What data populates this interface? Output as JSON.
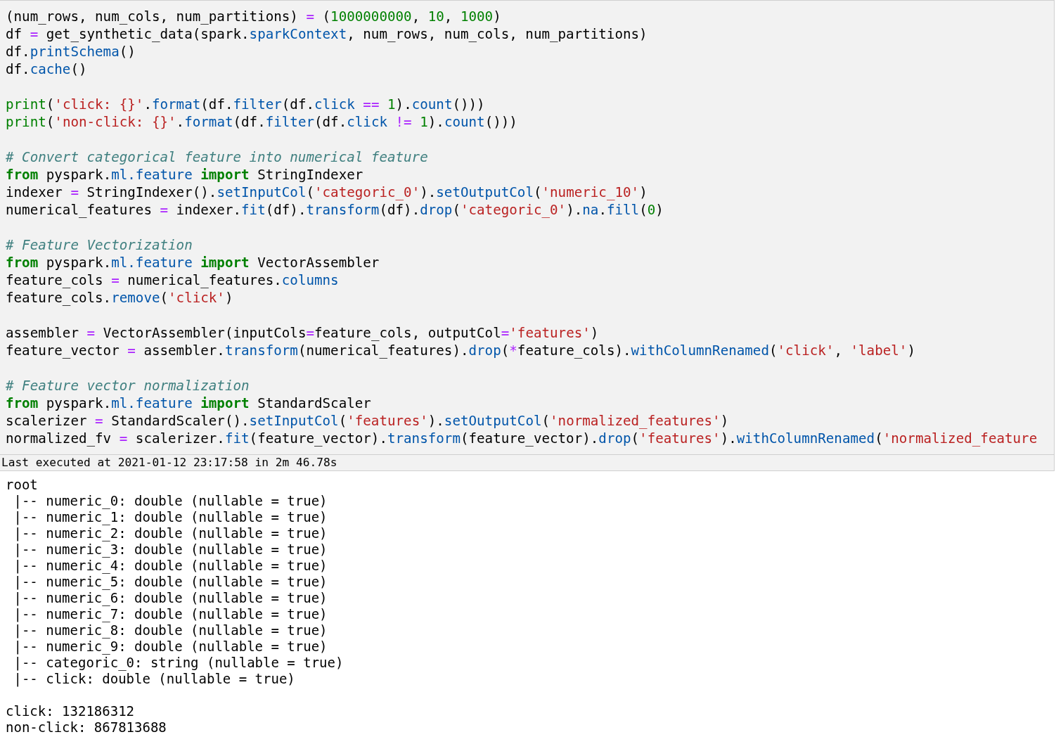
{
  "code_cell": {
    "blocks": [
      [
        {
          "tokens": [
            {
              "kind": "plain",
              "text": "(num_rows, num_cols, num_partitions) "
            },
            {
              "kind": "op",
              "text": "="
            },
            {
              "kind": "plain",
              "text": " ("
            },
            {
              "kind": "num",
              "text": "1000000000"
            },
            {
              "kind": "plain",
              "text": ", "
            },
            {
              "kind": "num",
              "text": "10"
            },
            {
              "kind": "plain",
              "text": ", "
            },
            {
              "kind": "num",
              "text": "1000"
            },
            {
              "kind": "plain",
              "text": ")"
            }
          ]
        },
        {
          "tokens": [
            {
              "kind": "plain",
              "text": "df "
            },
            {
              "kind": "op",
              "text": "="
            },
            {
              "kind": "plain",
              "text": " get_synthetic_data(spark."
            },
            {
              "kind": "attr",
              "text": "sparkContext"
            },
            {
              "kind": "plain",
              "text": ", num_rows, num_cols, num_partitions)"
            }
          ]
        },
        {
          "tokens": [
            {
              "kind": "plain",
              "text": "df."
            },
            {
              "kind": "attr",
              "text": "printSchema"
            },
            {
              "kind": "plain",
              "text": "()"
            }
          ]
        },
        {
          "tokens": [
            {
              "kind": "plain",
              "text": "df."
            },
            {
              "kind": "attr",
              "text": "cache"
            },
            {
              "kind": "plain",
              "text": "()"
            }
          ]
        }
      ],
      [
        {
          "tokens": [
            {
              "kind": "builtin",
              "text": "print"
            },
            {
              "kind": "plain",
              "text": "("
            },
            {
              "kind": "str",
              "text": "'click: {}'"
            },
            {
              "kind": "plain",
              "text": "."
            },
            {
              "kind": "attr",
              "text": "format"
            },
            {
              "kind": "plain",
              "text": "(df."
            },
            {
              "kind": "attr",
              "text": "filter"
            },
            {
              "kind": "plain",
              "text": "(df."
            },
            {
              "kind": "attr",
              "text": "click"
            },
            {
              "kind": "op",
              "text": " == "
            },
            {
              "kind": "num",
              "text": "1"
            },
            {
              "kind": "plain",
              "text": ")."
            },
            {
              "kind": "attr",
              "text": "count"
            },
            {
              "kind": "plain",
              "text": "()))"
            }
          ]
        },
        {
          "tokens": [
            {
              "kind": "builtin",
              "text": "print"
            },
            {
              "kind": "plain",
              "text": "("
            },
            {
              "kind": "str",
              "text": "'non-click: {}'"
            },
            {
              "kind": "plain",
              "text": "."
            },
            {
              "kind": "attr",
              "text": "format"
            },
            {
              "kind": "plain",
              "text": "(df."
            },
            {
              "kind": "attr",
              "text": "filter"
            },
            {
              "kind": "plain",
              "text": "(df."
            },
            {
              "kind": "attr",
              "text": "click"
            },
            {
              "kind": "op",
              "text": " != "
            },
            {
              "kind": "num",
              "text": "1"
            },
            {
              "kind": "plain",
              "text": ")."
            },
            {
              "kind": "attr",
              "text": "count"
            },
            {
              "kind": "plain",
              "text": "()))"
            }
          ]
        }
      ],
      [
        {
          "tokens": [
            {
              "kind": "comment",
              "text": "# Convert categorical feature into numerical feature"
            }
          ]
        },
        {
          "tokens": [
            {
              "kind": "keyword",
              "text": "from"
            },
            {
              "kind": "plain",
              "text": " pyspark."
            },
            {
              "kind": "attr",
              "text": "ml.feature"
            },
            {
              "kind": "keyword",
              "text": " import"
            },
            {
              "kind": "plain",
              "text": " StringIndexer"
            }
          ]
        },
        {
          "tokens": [
            {
              "kind": "plain",
              "text": "indexer "
            },
            {
              "kind": "op",
              "text": "="
            },
            {
              "kind": "plain",
              "text": " StringIndexer()."
            },
            {
              "kind": "attr",
              "text": "setInputCol"
            },
            {
              "kind": "plain",
              "text": "("
            },
            {
              "kind": "str",
              "text": "'categoric_0'"
            },
            {
              "kind": "plain",
              "text": ")."
            },
            {
              "kind": "attr",
              "text": "setOutputCol"
            },
            {
              "kind": "plain",
              "text": "("
            },
            {
              "kind": "str",
              "text": "'numeric_10'"
            },
            {
              "kind": "plain",
              "text": ")"
            }
          ]
        },
        {
          "tokens": [
            {
              "kind": "plain",
              "text": "numerical_features "
            },
            {
              "kind": "op",
              "text": "="
            },
            {
              "kind": "plain",
              "text": " indexer."
            },
            {
              "kind": "attr",
              "text": "fit"
            },
            {
              "kind": "plain",
              "text": "(df)."
            },
            {
              "kind": "attr",
              "text": "transform"
            },
            {
              "kind": "plain",
              "text": "(df)."
            },
            {
              "kind": "attr",
              "text": "drop"
            },
            {
              "kind": "plain",
              "text": "("
            },
            {
              "kind": "str",
              "text": "'categoric_0'"
            },
            {
              "kind": "plain",
              "text": ")."
            },
            {
              "kind": "attr",
              "text": "na"
            },
            {
              "kind": "plain",
              "text": "."
            },
            {
              "kind": "attr",
              "text": "fill"
            },
            {
              "kind": "plain",
              "text": "("
            },
            {
              "kind": "num",
              "text": "0"
            },
            {
              "kind": "plain",
              "text": ")"
            }
          ]
        }
      ],
      [
        {
          "tokens": [
            {
              "kind": "comment",
              "text": "# Feature Vectorization"
            }
          ]
        },
        {
          "tokens": [
            {
              "kind": "keyword",
              "text": "from"
            },
            {
              "kind": "plain",
              "text": " pyspark."
            },
            {
              "kind": "attr",
              "text": "ml.feature"
            },
            {
              "kind": "keyword",
              "text": " import"
            },
            {
              "kind": "plain",
              "text": " VectorAssembler"
            }
          ]
        },
        {
          "tokens": [
            {
              "kind": "plain",
              "text": "feature_cols "
            },
            {
              "kind": "op",
              "text": "="
            },
            {
              "kind": "plain",
              "text": " numerical_features."
            },
            {
              "kind": "attr",
              "text": "columns"
            }
          ]
        },
        {
          "tokens": [
            {
              "kind": "plain",
              "text": "feature_cols."
            },
            {
              "kind": "attr",
              "text": "remove"
            },
            {
              "kind": "plain",
              "text": "("
            },
            {
              "kind": "str",
              "text": "'click'"
            },
            {
              "kind": "plain",
              "text": ")"
            }
          ]
        }
      ],
      [
        {
          "tokens": [
            {
              "kind": "plain",
              "text": "assembler "
            },
            {
              "kind": "op",
              "text": "="
            },
            {
              "kind": "plain",
              "text": " VectorAssembler(inputCols"
            },
            {
              "kind": "op",
              "text": "="
            },
            {
              "kind": "plain",
              "text": "feature_cols, outputCol"
            },
            {
              "kind": "op",
              "text": "="
            },
            {
              "kind": "str",
              "text": "'features'"
            },
            {
              "kind": "plain",
              "text": ")"
            }
          ]
        },
        {
          "tokens": [
            {
              "kind": "plain",
              "text": "feature_vector "
            },
            {
              "kind": "op",
              "text": "="
            },
            {
              "kind": "plain",
              "text": " assembler."
            },
            {
              "kind": "attr",
              "text": "transform"
            },
            {
              "kind": "plain",
              "text": "(numerical_features)."
            },
            {
              "kind": "attr",
              "text": "drop"
            },
            {
              "kind": "plain",
              "text": "("
            },
            {
              "kind": "op",
              "text": "*"
            },
            {
              "kind": "plain",
              "text": "feature_cols)."
            },
            {
              "kind": "attr",
              "text": "withColumnRenamed"
            },
            {
              "kind": "plain",
              "text": "("
            },
            {
              "kind": "str",
              "text": "'click'"
            },
            {
              "kind": "plain",
              "text": ", "
            },
            {
              "kind": "str",
              "text": "'label'"
            },
            {
              "kind": "plain",
              "text": ")"
            }
          ]
        }
      ],
      [
        {
          "tokens": [
            {
              "kind": "comment",
              "text": "# Feature vector normalization"
            }
          ]
        },
        {
          "tokens": [
            {
              "kind": "keyword",
              "text": "from"
            },
            {
              "kind": "plain",
              "text": " pyspark."
            },
            {
              "kind": "attr",
              "text": "ml.feature"
            },
            {
              "kind": "keyword",
              "text": " import"
            },
            {
              "kind": "plain",
              "text": " StandardScaler"
            }
          ]
        },
        {
          "tokens": [
            {
              "kind": "plain",
              "text": "scalerizer "
            },
            {
              "kind": "op",
              "text": "="
            },
            {
              "kind": "plain",
              "text": " StandardScaler()."
            },
            {
              "kind": "attr",
              "text": "setInputCol"
            },
            {
              "kind": "plain",
              "text": "("
            },
            {
              "kind": "str",
              "text": "'features'"
            },
            {
              "kind": "plain",
              "text": ")."
            },
            {
              "kind": "attr",
              "text": "setOutputCol"
            },
            {
              "kind": "plain",
              "text": "("
            },
            {
              "kind": "str",
              "text": "'normalized_features'"
            },
            {
              "kind": "plain",
              "text": ")"
            }
          ]
        },
        {
          "tokens": [
            {
              "kind": "plain",
              "text": "normalized_fv "
            },
            {
              "kind": "op",
              "text": "="
            },
            {
              "kind": "plain",
              "text": " scalerizer."
            },
            {
              "kind": "attr",
              "text": "fit"
            },
            {
              "kind": "plain",
              "text": "(feature_vector)."
            },
            {
              "kind": "attr",
              "text": "transform"
            },
            {
              "kind": "plain",
              "text": "(feature_vector)."
            },
            {
              "kind": "attr",
              "text": "drop"
            },
            {
              "kind": "plain",
              "text": "("
            },
            {
              "kind": "str",
              "text": "'features'"
            },
            {
              "kind": "plain",
              "text": ")."
            },
            {
              "kind": "attr",
              "text": "withColumnRenamed"
            },
            {
              "kind": "plain",
              "text": "("
            },
            {
              "kind": "str",
              "text": "'normalized_feature"
            }
          ]
        }
      ]
    ],
    "last_executed": "Last executed at 2021-01-12 23:17:58 in 2m 46.78s"
  },
  "output": {
    "blocks": [
      [
        "root",
        " |-- numeric_0: double (nullable = true)",
        " |-- numeric_1: double (nullable = true)",
        " |-- numeric_2: double (nullable = true)",
        " |-- numeric_3: double (nullable = true)",
        " |-- numeric_4: double (nullable = true)",
        " |-- numeric_5: double (nullable = true)",
        " |-- numeric_6: double (nullable = true)",
        " |-- numeric_7: double (nullable = true)",
        " |-- numeric_8: double (nullable = true)",
        " |-- numeric_9: double (nullable = true)",
        " |-- categoric_0: string (nullable = true)",
        " |-- click: double (nullable = true)"
      ],
      [
        "click: 132186312",
        "non-click: 867813688"
      ]
    ]
  }
}
